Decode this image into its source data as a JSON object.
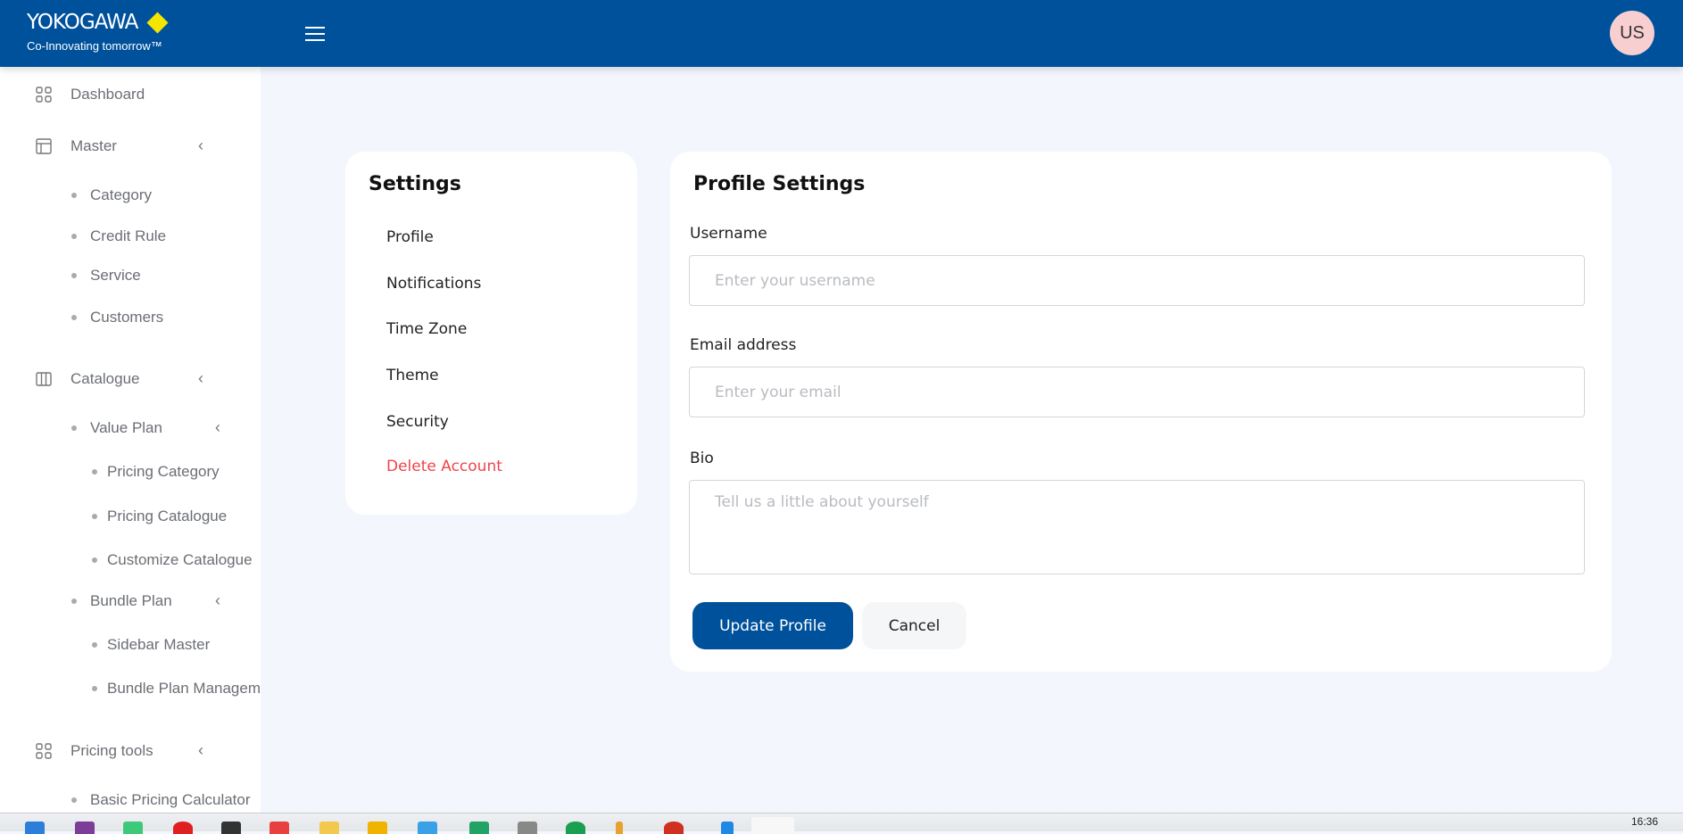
{
  "header": {
    "brand": "YOKOGAWA",
    "tagline": "Co-Innovating tomorrow™",
    "avatar_initials": "US"
  },
  "sidebar": {
    "items": [
      {
        "label": "Dashboard",
        "icon": "grid-icon",
        "level": 0
      },
      {
        "label": "Master",
        "icon": "layout-icon",
        "level": 0,
        "chevron": true
      },
      {
        "label": "Category",
        "level": 1
      },
      {
        "label": "Credit Rule",
        "level": 1
      },
      {
        "label": "Service",
        "level": 1
      },
      {
        "label": "Customers",
        "level": 1
      },
      {
        "label": "Catalogue",
        "icon": "columns-icon",
        "level": 0,
        "chevron": true
      },
      {
        "label": "Value Plan",
        "level": 1,
        "chevron": true
      },
      {
        "label": "Pricing Category",
        "level": 2
      },
      {
        "label": "Pricing Catalogue",
        "level": 2
      },
      {
        "label": "Customize Catalogue",
        "level": 2
      },
      {
        "label": "Bundle Plan",
        "level": 1,
        "chevron": true
      },
      {
        "label": "Sidebar Master",
        "level": 2
      },
      {
        "label": "Bundle Plan Management",
        "level": 2
      },
      {
        "label": "Pricing tools",
        "icon": "grid-icon",
        "level": 0,
        "chevron": true
      },
      {
        "label": "Basic Pricing Calculator",
        "level": 1
      }
    ]
  },
  "settings": {
    "title": "Settings",
    "items": [
      "Profile",
      "Notifications",
      "Time Zone",
      "Theme",
      "Security",
      "Delete Account"
    ]
  },
  "profile": {
    "title": "Profile Settings",
    "username_label": "Username",
    "username_placeholder": "Enter your username",
    "username_value": "",
    "email_label": "Email address",
    "email_placeholder": "Enter your email",
    "email_value": "",
    "bio_label": "Bio",
    "bio_placeholder": "Tell us a little about yourself",
    "bio_value": "",
    "update_label": "Update Profile",
    "cancel_label": "Cancel"
  },
  "taskbar": {
    "time": "16:36"
  },
  "colors": {
    "primary": "#00519c",
    "danger": "#f0444a",
    "logo_diamond": "#f5e600"
  }
}
